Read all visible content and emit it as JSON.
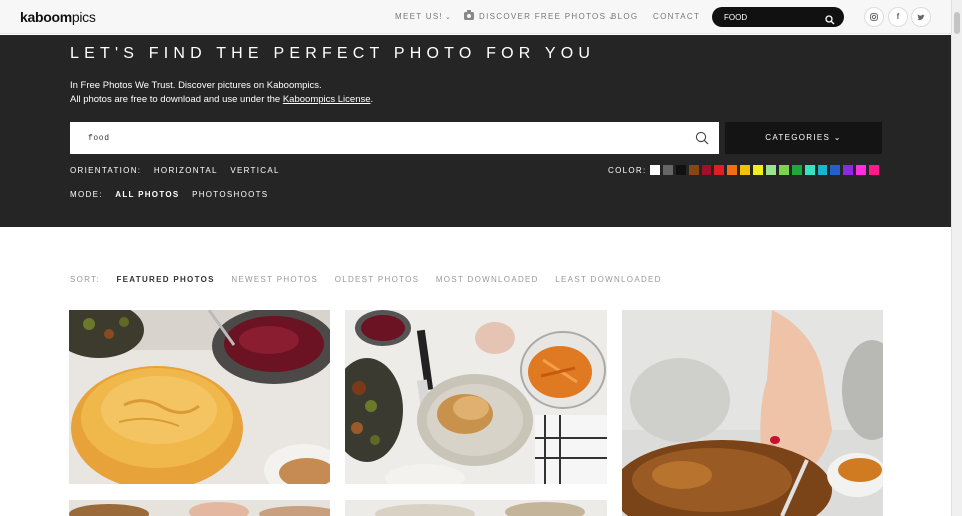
{
  "brand": {
    "logo_bold": "kaboom",
    "logo_light": "pics"
  },
  "nav": {
    "links": [
      "MEET US!",
      "DISCOVER FREE PHOTOS",
      "BLOG",
      "CONTACT"
    ],
    "search_value": "FOOD",
    "social_icons": [
      "instagram-icon",
      "facebook-icon",
      "twitter-icon"
    ]
  },
  "hero": {
    "title": "LET'S FIND THE PERFECT PHOTO FOR YOU",
    "desc_line1": "In Free Photos We Trust. Discover pictures on Kaboompics.",
    "desc_line2_prefix": "All photos are free to download and use under the ",
    "license_link": "Kaboompics License",
    "desc_line2_suffix": ".",
    "search_value": "food",
    "categories_label": "CATEGORIES"
  },
  "filters": {
    "orientation_label": "ORIENTATION:",
    "orientation_options": [
      "HORIZONTAL",
      "VERTICAL"
    ],
    "mode_label": "MODE:",
    "mode_options": [
      "ALL PHOTOS",
      "PHOTOSHOOTS"
    ],
    "color_label": "COLOR:",
    "colors": [
      "#ffffff",
      "#666666",
      "#111111",
      "#8b4513",
      "#a0102a",
      "#e02020",
      "#f07010",
      "#f5c000",
      "#f2ee1a",
      "#9be38c",
      "#7cd44a",
      "#1fa83a",
      "#3be0c0",
      "#18b4d0",
      "#2060d0",
      "#8a2be2",
      "#ff2fe0",
      "#ff1a8c"
    ]
  },
  "sort": {
    "label": "SORT:",
    "options": [
      "FEATURED PHOTOS",
      "NEWEST PHOTOS",
      "OLDEST PHOTOS",
      "MOST DOWNLOADED",
      "LEAST DOWNLOADED"
    ]
  }
}
